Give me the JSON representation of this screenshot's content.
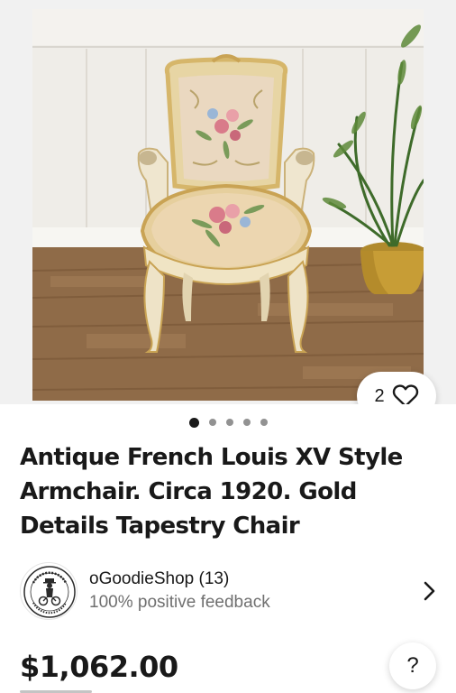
{
  "gallery": {
    "photo_subject": "antique-armchair",
    "image_count": 5,
    "active_index": 0
  },
  "watch": {
    "count": "2",
    "icon": "heart-icon"
  },
  "listing": {
    "title": "Antique French Louis XV Style Armchair. Circa 1920. Gold Details Tapestry Chair"
  },
  "seller": {
    "name": "oGoodieShop (13)",
    "feedback": "100% positive feedback",
    "avatar_icon": "seller-logo-icon"
  },
  "price": {
    "amount": "$1,062.00"
  },
  "help": {
    "label": "?"
  },
  "colors": {
    "text": "#191919",
    "muted": "#707070",
    "dot_inactive": "#929292",
    "gallery_bg": "#f1f1f1"
  }
}
